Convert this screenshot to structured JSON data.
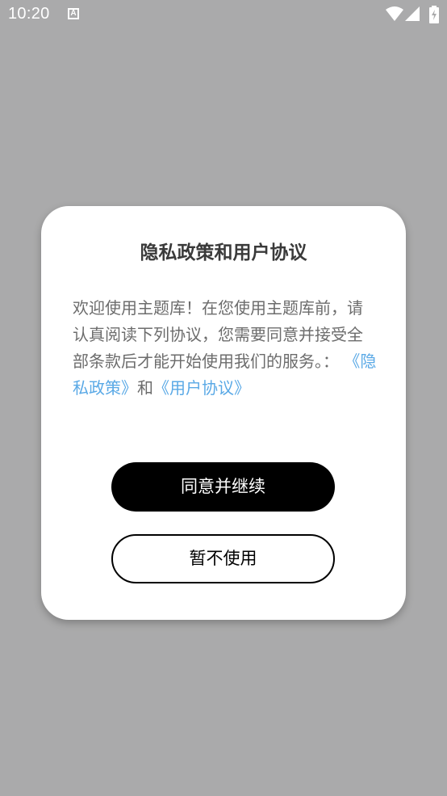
{
  "status_bar": {
    "time": "10:20",
    "notification_icon": "a-icon",
    "icons": [
      "wifi-icon",
      "cell-signal-icon",
      "battery-charging-icon"
    ]
  },
  "dialog": {
    "title": "隐私政策和用户协议",
    "body_text": "欢迎使用主题库！在您使用主题库前，请认真阅读下列协议，您需要同意并接受全部条款后才能开始使用我们的服务。：",
    "privacy_link": "《隐私政策》",
    "conjunction": "和",
    "user_agreement_link": "《用户协议》",
    "agree_button": "同意并继续",
    "decline_button": "暂不使用"
  },
  "colors": {
    "overlay": "#aaaaab",
    "link": "#5aa9e6",
    "primary_button": "#000000"
  }
}
